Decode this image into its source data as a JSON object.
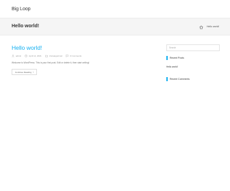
{
  "site": {
    "title": "Big Loop"
  },
  "page_header": {
    "title": "Hello world!",
    "breadcrumb": "Hello world!"
  },
  "post": {
    "title": "Hello world!",
    "meta": {
      "author": "admin",
      "date": "April 14, 2021",
      "category": "Uncategorized",
      "comments": "0 Comments"
    },
    "excerpt": "Welcome to WordPress. This is your first post. Edit or delete it, then start writing!",
    "continue_label": "Continue Reading"
  },
  "sidebar": {
    "search_placeholder": "Search",
    "recent_posts": {
      "title": "Recent Posts",
      "items": [
        "Hello world!"
      ]
    },
    "recent_comments": {
      "title": "Recent Comments"
    }
  },
  "colors": {
    "accent": "#13aff0",
    "header_band": "#f5f5f5",
    "text": "#333333",
    "muted": "#999999"
  }
}
